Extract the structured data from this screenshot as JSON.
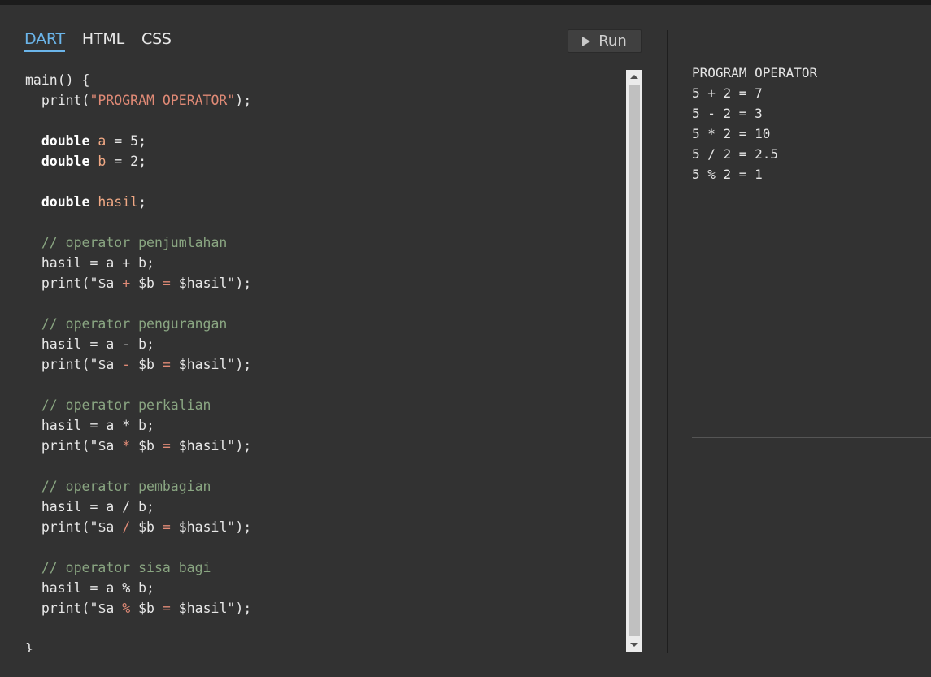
{
  "tabs": [
    {
      "label": "DART",
      "active": true
    },
    {
      "label": "HTML",
      "active": false
    },
    {
      "label": "CSS",
      "active": false
    }
  ],
  "run_button": {
    "label": "Run",
    "icon": "play-icon"
  },
  "code_lines": [
    [
      [
        "t",
        "main() {"
      ]
    ],
    [
      [
        "t",
        "  print("
      ],
      [
        "str",
        "\"PROGRAM OPERATOR\""
      ],
      [
        "t",
        ");"
      ]
    ],
    [],
    [
      [
        "t",
        "  "
      ],
      [
        "kw",
        "double"
      ],
      [
        "t",
        " "
      ],
      [
        "v",
        "a"
      ],
      [
        "t",
        " = 5;"
      ]
    ],
    [
      [
        "t",
        "  "
      ],
      [
        "kw",
        "double"
      ],
      [
        "t",
        " "
      ],
      [
        "v",
        "b"
      ],
      [
        "t",
        " = 2;"
      ]
    ],
    [],
    [
      [
        "t",
        "  "
      ],
      [
        "kw",
        "double"
      ],
      [
        "t",
        " "
      ],
      [
        "v",
        "hasil"
      ],
      [
        "t",
        ";"
      ]
    ],
    [],
    [
      [
        "cm",
        "  // operator penjumlahan"
      ]
    ],
    [
      [
        "t",
        "  hasil = a "
      ],
      [
        "op",
        "+"
      ],
      [
        "t",
        " b;"
      ]
    ],
    [
      [
        "t",
        "  print(\"$a "
      ],
      [
        "str",
        "+"
      ],
      [
        "t",
        " $b "
      ],
      [
        "str",
        "="
      ],
      [
        "t",
        " $hasil\");"
      ]
    ],
    [],
    [
      [
        "cm",
        "  // operator pengurangan"
      ]
    ],
    [
      [
        "t",
        "  hasil = a "
      ],
      [
        "op",
        "-"
      ],
      [
        "t",
        " b;"
      ]
    ],
    [
      [
        "t",
        "  print(\"$a "
      ],
      [
        "str",
        "-"
      ],
      [
        "t",
        " $b "
      ],
      [
        "str",
        "="
      ],
      [
        "t",
        " $hasil\");"
      ]
    ],
    [],
    [
      [
        "cm",
        "  // operator perkalian"
      ]
    ],
    [
      [
        "t",
        "  hasil = a "
      ],
      [
        "op",
        "*"
      ],
      [
        "t",
        " b;"
      ]
    ],
    [
      [
        "t",
        "  print(\"$a "
      ],
      [
        "str",
        "*"
      ],
      [
        "t",
        " $b "
      ],
      [
        "str",
        "="
      ],
      [
        "t",
        " $hasil\");"
      ]
    ],
    [],
    [
      [
        "cm",
        "  // operator pembagian"
      ]
    ],
    [
      [
        "t",
        "  hasil = a "
      ],
      [
        "op",
        "/"
      ],
      [
        "t",
        " b;"
      ]
    ],
    [
      [
        "t",
        "  print(\"$a "
      ],
      [
        "str",
        "/"
      ],
      [
        "t",
        " $b "
      ],
      [
        "str",
        "="
      ],
      [
        "t",
        " $hasil\");"
      ]
    ],
    [],
    [
      [
        "cm",
        "  // operator sisa bagi"
      ]
    ],
    [
      [
        "t",
        "  hasil = a "
      ],
      [
        "op",
        "%"
      ],
      [
        "t",
        " b;"
      ]
    ],
    [
      [
        "t",
        "  print(\"$a "
      ],
      [
        "str",
        "%"
      ],
      [
        "t",
        " $b "
      ],
      [
        "str",
        "="
      ],
      [
        "t",
        " $hasil\");"
      ]
    ],
    [],
    [
      [
        "t",
        "}"
      ]
    ]
  ],
  "output_lines": [
    "PROGRAM OPERATOR",
    "5 + 2 = 7",
    "5 - 2 = 3",
    "5 * 2 = 10",
    "5 / 2 = 2.5",
    "5 % 2 = 1"
  ],
  "colors": {
    "background": "#323232",
    "active_tab": "#6bb5ea",
    "string": "#e08a76",
    "comment": "#8aa682",
    "variable": "#f0a884"
  }
}
